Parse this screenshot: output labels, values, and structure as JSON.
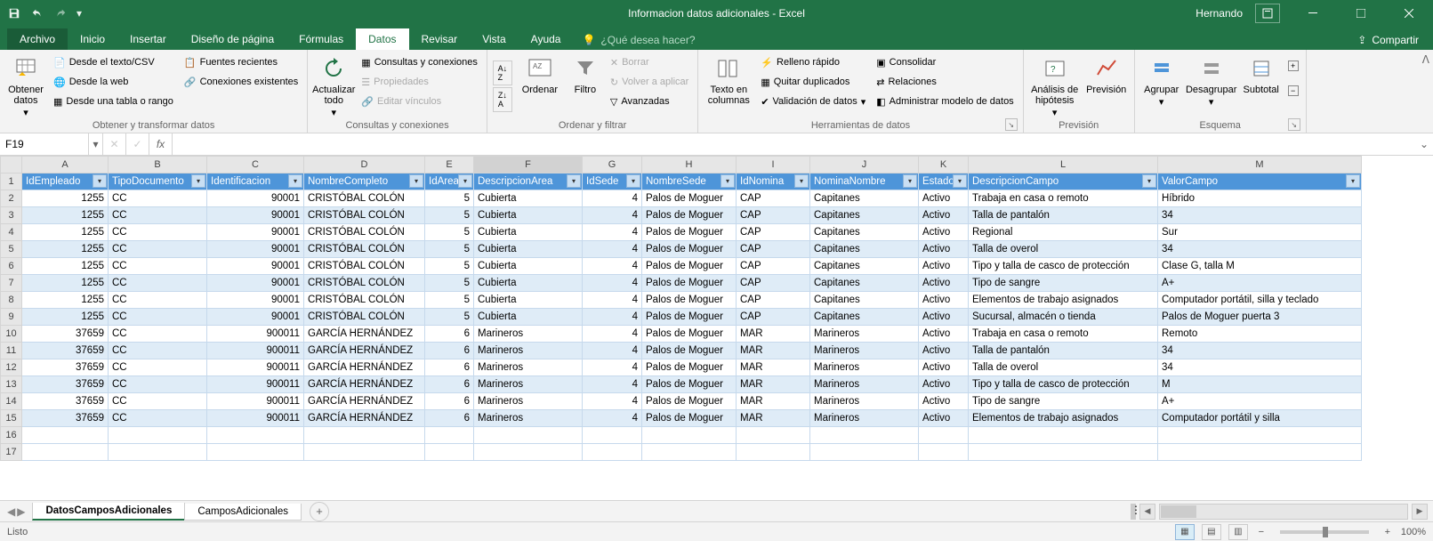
{
  "app": {
    "title": "Informacion datos adicionales  -  Excel",
    "suffix": "",
    "user": "Hernando"
  },
  "menu": {
    "file": "Archivo",
    "home": "Inicio",
    "insert": "Insertar",
    "layout": "Diseño de página",
    "formulas": "Fórmulas",
    "data": "Datos",
    "review": "Revisar",
    "view": "Vista",
    "help": "Ayuda",
    "tellme": "¿Qué desea hacer?",
    "share": "Compartir"
  },
  "ribbon": {
    "group1": {
      "obtain": "Obtener datos",
      "csv": "Desde el texto/CSV",
      "web": "Desde la web",
      "table": "Desde una tabla o rango",
      "recent": "Fuentes recientes",
      "existing": "Conexiones existentes",
      "label": "Obtener y transformar datos"
    },
    "group2": {
      "refresh": "Actualizar todo",
      "queries": "Consultas y conexiones",
      "props": "Propiedades",
      "editlinks": "Editar vínculos",
      "label": "Consultas y conexiones"
    },
    "group3": {
      "sort": "Ordenar",
      "filter": "Filtro",
      "clear": "Borrar",
      "reapply": "Volver a aplicar",
      "adv": "Avanzadas",
      "label": "Ordenar y filtrar"
    },
    "group4": {
      "ttc": "Texto en columnas",
      "flash": "Relleno rápido",
      "dup": "Quitar duplicados",
      "valid": "Validación de datos",
      "consol": "Consolidar",
      "rel": "Relaciones",
      "model": "Administrar modelo de datos",
      "label": "Herramientas de datos"
    },
    "group5": {
      "whatif": "Análisis de hipótesis",
      "forecast": "Previsión",
      "label": "Previsión"
    },
    "group6": {
      "group": "Agrupar",
      "ungroup": "Desagrupar",
      "subtotal": "Subtotal",
      "label": "Esquema"
    }
  },
  "fbar": {
    "name": "F19"
  },
  "columns": {
    "letters": [
      "A",
      "B",
      "C",
      "D",
      "E",
      "F",
      "G",
      "H",
      "I",
      "J",
      "K",
      "L",
      "M"
    ],
    "widths": [
      97,
      111,
      109,
      136,
      55,
      122,
      67,
      106,
      83,
      122,
      56,
      213,
      229
    ]
  },
  "headers": [
    "IdEmpleado",
    "TipoDocumento",
    "Identificacion",
    "NombreCompleto",
    "IdArea",
    "DescripcionArea",
    "IdSede",
    "NombreSede",
    "IdNomina",
    "NominaNombre",
    "Estado",
    "DescripcionCampo",
    "ValorCampo"
  ],
  "rows": [
    {
      "IdEmpleado": 1255,
      "TipoDocumento": "CC",
      "Identificacion": 90001,
      "NombreCompleto": "CRISTÓBAL COLÓN",
      "IdArea": 5,
      "DescripcionArea": "Cubierta",
      "IdSede": 4,
      "NombreSede": "Palos de Moguer",
      "IdNomina": "CAP",
      "NominaNombre": "Capitanes",
      "Estado": "Activo",
      "DescripcionCampo": "Trabaja en casa o remoto",
      "ValorCampo": "Híbrido"
    },
    {
      "IdEmpleado": 1255,
      "TipoDocumento": "CC",
      "Identificacion": 90001,
      "NombreCompleto": "CRISTÓBAL COLÓN",
      "IdArea": 5,
      "DescripcionArea": "Cubierta",
      "IdSede": 4,
      "NombreSede": "Palos de Moguer",
      "IdNomina": "CAP",
      "NominaNombre": "Capitanes",
      "Estado": "Activo",
      "DescripcionCampo": "Talla de pantalón",
      "ValorCampo": "34"
    },
    {
      "IdEmpleado": 1255,
      "TipoDocumento": "CC",
      "Identificacion": 90001,
      "NombreCompleto": "CRISTÓBAL COLÓN",
      "IdArea": 5,
      "DescripcionArea": "Cubierta",
      "IdSede": 4,
      "NombreSede": "Palos de Moguer",
      "IdNomina": "CAP",
      "NominaNombre": "Capitanes",
      "Estado": "Activo",
      "DescripcionCampo": "Regional",
      "ValorCampo": "Sur"
    },
    {
      "IdEmpleado": 1255,
      "TipoDocumento": "CC",
      "Identificacion": 90001,
      "NombreCompleto": "CRISTÓBAL COLÓN",
      "IdArea": 5,
      "DescripcionArea": "Cubierta",
      "IdSede": 4,
      "NombreSede": "Palos de Moguer",
      "IdNomina": "CAP",
      "NominaNombre": "Capitanes",
      "Estado": "Activo",
      "DescripcionCampo": "Talla de overol",
      "ValorCampo": "34"
    },
    {
      "IdEmpleado": 1255,
      "TipoDocumento": "CC",
      "Identificacion": 90001,
      "NombreCompleto": "CRISTÓBAL COLÓN",
      "IdArea": 5,
      "DescripcionArea": "Cubierta",
      "IdSede": 4,
      "NombreSede": "Palos de Moguer",
      "IdNomina": "CAP",
      "NominaNombre": "Capitanes",
      "Estado": "Activo",
      "DescripcionCampo": "Tipo y talla de casco de protección",
      "ValorCampo": "Clase G, talla M"
    },
    {
      "IdEmpleado": 1255,
      "TipoDocumento": "CC",
      "Identificacion": 90001,
      "NombreCompleto": "CRISTÓBAL COLÓN",
      "IdArea": 5,
      "DescripcionArea": "Cubierta",
      "IdSede": 4,
      "NombreSede": "Palos de Moguer",
      "IdNomina": "CAP",
      "NominaNombre": "Capitanes",
      "Estado": "Activo",
      "DescripcionCampo": "Tipo de sangre",
      "ValorCampo": "A+"
    },
    {
      "IdEmpleado": 1255,
      "TipoDocumento": "CC",
      "Identificacion": 90001,
      "NombreCompleto": "CRISTÓBAL COLÓN",
      "IdArea": 5,
      "DescripcionArea": "Cubierta",
      "IdSede": 4,
      "NombreSede": "Palos de Moguer",
      "IdNomina": "CAP",
      "NominaNombre": "Capitanes",
      "Estado": "Activo",
      "DescripcionCampo": "Elementos de trabajo asignados",
      "ValorCampo": "Computador portátil, silla y teclado"
    },
    {
      "IdEmpleado": 1255,
      "TipoDocumento": "CC",
      "Identificacion": 90001,
      "NombreCompleto": "CRISTÓBAL COLÓN",
      "IdArea": 5,
      "DescripcionArea": "Cubierta",
      "IdSede": 4,
      "NombreSede": "Palos de Moguer",
      "IdNomina": "CAP",
      "NominaNombre": "Capitanes",
      "Estado": "Activo",
      "DescripcionCampo": "Sucursal, almacén o tienda",
      "ValorCampo": "Palos de Moguer puerta 3"
    },
    {
      "IdEmpleado": 37659,
      "TipoDocumento": "CC",
      "Identificacion": 900011,
      "NombreCompleto": "GARCÍA HERNÁNDEZ",
      "IdArea": 6,
      "DescripcionArea": "Marineros",
      "IdSede": 4,
      "NombreSede": "Palos de Moguer",
      "IdNomina": "MAR",
      "NominaNombre": "Marineros",
      "Estado": "Activo",
      "DescripcionCampo": "Trabaja en casa o remoto",
      "ValorCampo": "Remoto"
    },
    {
      "IdEmpleado": 37659,
      "TipoDocumento": "CC",
      "Identificacion": 900011,
      "NombreCompleto": "GARCÍA HERNÁNDEZ",
      "IdArea": 6,
      "DescripcionArea": "Marineros",
      "IdSede": 4,
      "NombreSede": "Palos de Moguer",
      "IdNomina": "MAR",
      "NominaNombre": "Marineros",
      "Estado": "Activo",
      "DescripcionCampo": "Talla de pantalón",
      "ValorCampo": "34"
    },
    {
      "IdEmpleado": 37659,
      "TipoDocumento": "CC",
      "Identificacion": 900011,
      "NombreCompleto": "GARCÍA HERNÁNDEZ",
      "IdArea": 6,
      "DescripcionArea": "Marineros",
      "IdSede": 4,
      "NombreSede": "Palos de Moguer",
      "IdNomina": "MAR",
      "NominaNombre": "Marineros",
      "Estado": "Activo",
      "DescripcionCampo": "Talla de overol",
      "ValorCampo": "34"
    },
    {
      "IdEmpleado": 37659,
      "TipoDocumento": "CC",
      "Identificacion": 900011,
      "NombreCompleto": "GARCÍA HERNÁNDEZ",
      "IdArea": 6,
      "DescripcionArea": "Marineros",
      "IdSede": 4,
      "NombreSede": "Palos de Moguer",
      "IdNomina": "MAR",
      "NominaNombre": "Marineros",
      "Estado": "Activo",
      "DescripcionCampo": "Tipo y talla de casco de protección",
      "ValorCampo": "M"
    },
    {
      "IdEmpleado": 37659,
      "TipoDocumento": "CC",
      "Identificacion": 900011,
      "NombreCompleto": "GARCÍA HERNÁNDEZ",
      "IdArea": 6,
      "DescripcionArea": "Marineros",
      "IdSede": 4,
      "NombreSede": "Palos de Moguer",
      "IdNomina": "MAR",
      "NominaNombre": "Marineros",
      "Estado": "Activo",
      "DescripcionCampo": "Tipo de sangre",
      "ValorCampo": "A+"
    },
    {
      "IdEmpleado": 37659,
      "TipoDocumento": "CC",
      "Identificacion": 900011,
      "NombreCompleto": "GARCÍA HERNÁNDEZ",
      "IdArea": 6,
      "DescripcionArea": "Marineros",
      "IdSede": 4,
      "NombreSede": "Palos de Moguer",
      "IdNomina": "MAR",
      "NominaNombre": "Marineros",
      "Estado": "Activo",
      "DescripcionCampo": "Elementos de trabajo asignados",
      "ValorCampo": "Computador portátil y silla"
    }
  ],
  "emptyRows": [
    16,
    17
  ],
  "sheets": {
    "active": "DatosCamposAdicionales",
    "inactive": "CamposAdicionales"
  },
  "status": {
    "ready": "Listo",
    "zoom": "100%"
  },
  "numericCols": [
    "IdEmpleado",
    "Identificacion",
    "IdArea",
    "IdSede"
  ]
}
